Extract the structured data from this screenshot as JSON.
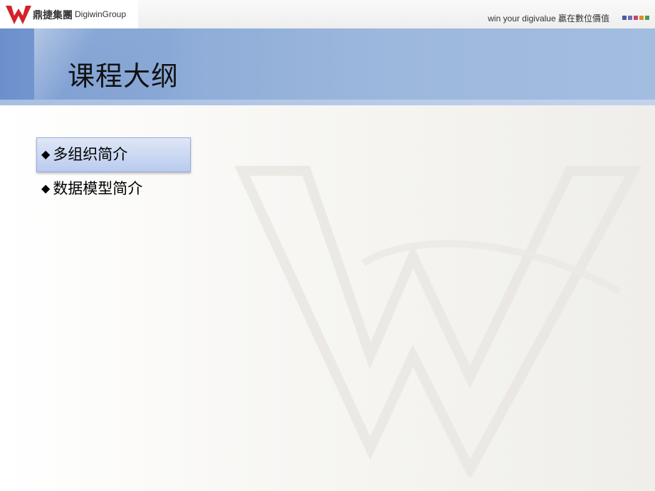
{
  "header": {
    "logo_cn": "鼎捷集團",
    "logo_en": "DigiwinGroup",
    "slogan": "win your digivalue 贏在數位價值",
    "square_colors": [
      "#4a5aa8",
      "#6a6ac0",
      "#c04a6a",
      "#e08a2a",
      "#4a9a4a"
    ]
  },
  "slide": {
    "title": "课程大纲",
    "items": [
      {
        "bullet": "◆",
        "label": "多组织简介"
      },
      {
        "bullet": "◆",
        "label": "数据模型简介"
      }
    ]
  },
  "colors": {
    "banner": "#9db8dd",
    "highlight": "#c9d7f1",
    "logo_red": "#d2232a"
  }
}
